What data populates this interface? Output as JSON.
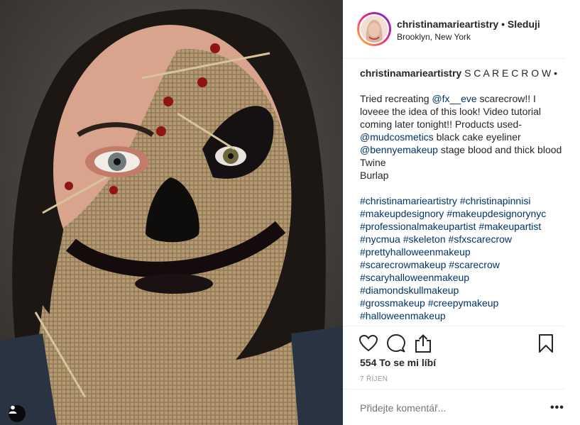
{
  "post": {
    "image_alt": "Scarecrow makeup look photo",
    "tag_icon": "user-tag-icon"
  },
  "header": {
    "username": "christinamarieartistry",
    "separator": "•",
    "follow_label": "Sleduji",
    "location": "Brooklyn, New York"
  },
  "caption": {
    "username": "christinamarieartistry",
    "title": "S C A R E C R O W •",
    "lines": [
      {
        "parts": [
          {
            "t": "Tried recreating "
          },
          {
            "t": "@fx__eve",
            "link": true
          },
          {
            "t": " scarecrow!! I loveee the idea of this look! Video tutorial coming later tonight!! Products used-"
          }
        ]
      },
      {
        "parts": [
          {
            "t": "@mudcosmetics",
            "link": true
          },
          {
            "t": " black cake eyeliner"
          }
        ]
      },
      {
        "parts": [
          {
            "t": "@bennyemakeup",
            "link": true
          },
          {
            "t": " stage blood and thick blood"
          }
        ]
      },
      {
        "parts": [
          {
            "t": "Twine"
          }
        ]
      },
      {
        "parts": [
          {
            "t": "Burlap"
          }
        ]
      },
      {
        "gap": true
      },
      {
        "parts": [
          {
            "t": "#christinamarieartistry",
            "link": true
          },
          {
            "t": " "
          },
          {
            "t": "#christinapinnisi",
            "link": true
          }
        ]
      },
      {
        "parts": [
          {
            "t": "#makeupdesignory",
            "link": true
          },
          {
            "t": " "
          },
          {
            "t": "#makeupdesignorynyc",
            "link": true
          }
        ]
      },
      {
        "parts": [
          {
            "t": "#professionalmakeupartist",
            "link": true
          },
          {
            "t": " "
          },
          {
            "t": "#makeupartist",
            "link": true
          }
        ]
      },
      {
        "parts": [
          {
            "t": "#nycmua",
            "link": true
          },
          {
            "t": " "
          },
          {
            "t": "#skeleton",
            "link": true
          },
          {
            "t": " "
          },
          {
            "t": "#sfxscarecrow",
            "link": true
          }
        ]
      },
      {
        "parts": [
          {
            "t": "#prettyhalloweenmakeup",
            "link": true
          }
        ]
      },
      {
        "parts": [
          {
            "t": "#scarecrowmakeup",
            "link": true
          },
          {
            "t": " "
          },
          {
            "t": "#scarecrow",
            "link": true
          }
        ]
      },
      {
        "parts": [
          {
            "t": "#scaryhalloweenmakeup",
            "link": true
          }
        ]
      },
      {
        "parts": [
          {
            "t": "#diamondskullmakeup",
            "link": true
          }
        ]
      },
      {
        "parts": [
          {
            "t": "#grossmakeup",
            "link": true
          },
          {
            "t": " "
          },
          {
            "t": "#creepymakeup",
            "link": true
          }
        ]
      },
      {
        "parts": [
          {
            "t": "#halloweenmakeup",
            "link": true
          }
        ]
      }
    ]
  },
  "actions": {
    "like_icon": "heart-icon",
    "comment_icon": "comment-icon",
    "share_icon": "share-icon",
    "save_icon": "bookmark-icon"
  },
  "likes": {
    "count": "554",
    "label": "To se mi líbí"
  },
  "date": "7 ŘÍJEN",
  "comment_box": {
    "placeholder": "Přidejte komentář..."
  },
  "more_label": "•••",
  "colors": {
    "link": "#003569",
    "text": "#262626",
    "muted": "#999999"
  }
}
